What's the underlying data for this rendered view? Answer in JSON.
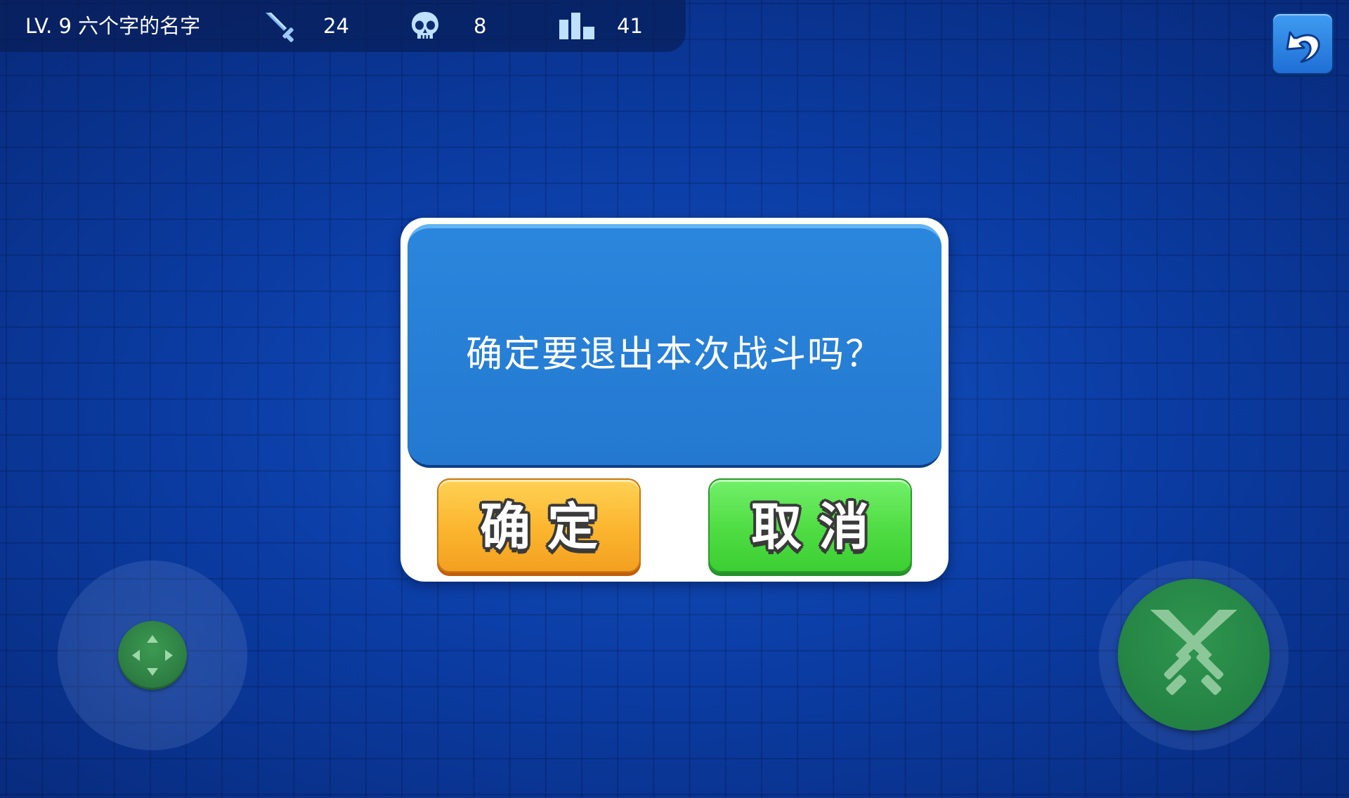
{
  "hud": {
    "player_label": "LV. 9 六个字的名字",
    "kills": "24",
    "deaths": "8",
    "score": "41",
    "icons": [
      "sword-icon",
      "skull-icon",
      "bar-chart-icon"
    ]
  },
  "back_button": {
    "icon": "back-arrow-icon"
  },
  "dialog": {
    "message": "确定要退出本次战斗吗？",
    "confirm_label": "确定",
    "cancel_label": "取消"
  },
  "controls": {
    "joystick_icon": "dpad-icon",
    "attack_icon": "crossed-swords-icon"
  },
  "colors": {
    "background": "#0a3aa0",
    "dialog_panel": "#2478d0",
    "confirm_button": "#fbb52e",
    "cancel_button": "#4fdc43",
    "attack_button": "#1f7a3e",
    "back_button": "#2a85e0"
  }
}
